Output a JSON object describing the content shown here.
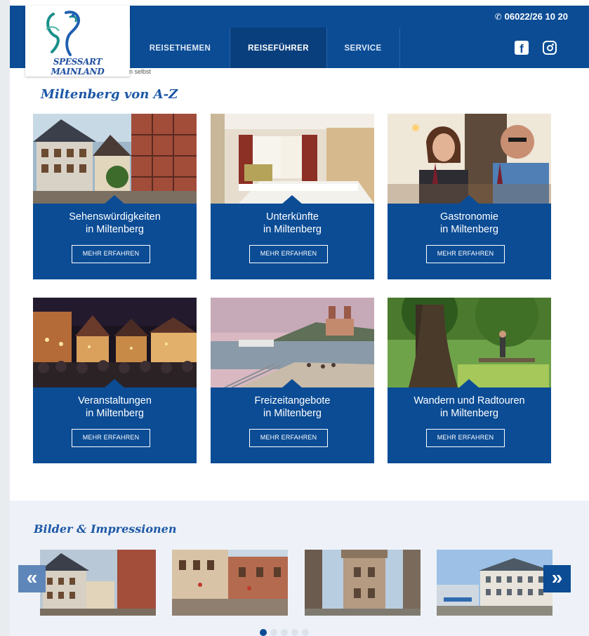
{
  "header": {
    "phone": "06022/26 10 20",
    "phone_icon": "phone-icon",
    "logo_text": "SPESSART MAINLAND",
    "logo_fragment": "n selbst",
    "nav": [
      {
        "label": "REISETHEMEN",
        "active": false
      },
      {
        "label": "REISEFÜHRER",
        "active": true
      },
      {
        "label": "SERVICE",
        "active": false
      }
    ],
    "social": [
      {
        "icon": "facebook-icon",
        "glyph": "f"
      },
      {
        "icon": "instagram-icon"
      }
    ]
  },
  "section_az": {
    "title": "Miltenberg von A-Z",
    "cards": [
      {
        "title1": "Sehenswürdigkeiten",
        "title2": "in Miltenberg",
        "button": "MEHR ERFAHREN"
      },
      {
        "title1": "Unterkünfte",
        "title2": "in Miltenberg",
        "button": "MEHR ERFAHREN"
      },
      {
        "title1": "Gastronomie",
        "title2": "in Miltenberg",
        "button": "MEHR ERFAHREN"
      },
      {
        "title1": "Veranstaltungen",
        "title2": "in Miltenberg",
        "button": "MEHR ERFAHREN"
      },
      {
        "title1": "Freizeitangebote",
        "title2": "in Miltenberg",
        "button": "MEHR ERFAHREN"
      },
      {
        "title1": "Wandern und Radtouren",
        "title2": "in Miltenberg",
        "button": "MEHR ERFAHREN"
      }
    ]
  },
  "gallery": {
    "title": "Bilder & Impressionen",
    "prev": "«",
    "next": "»",
    "dots_count": 5,
    "active_dot": 1
  },
  "colors": {
    "brand_blue": "#0b4c95",
    "title_blue": "#1d58a6",
    "gallery_bg": "#eef2f8"
  }
}
